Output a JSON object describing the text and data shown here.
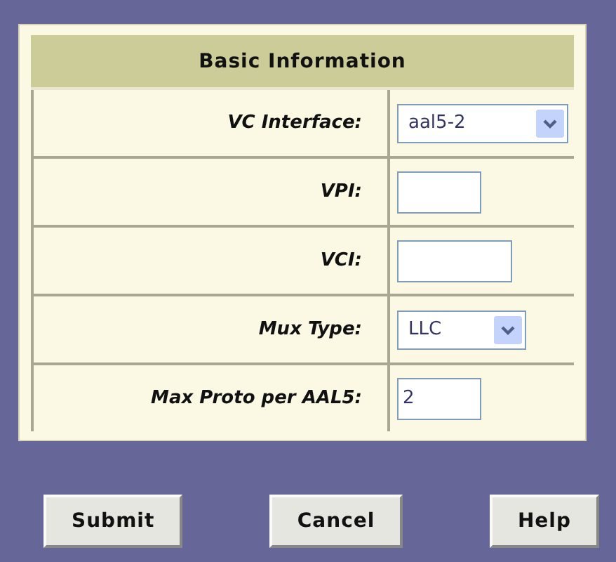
{
  "section": {
    "title": "Basic Information"
  },
  "fields": [
    {
      "label": "VC Interface:",
      "kind": "select",
      "value": "aal5-2"
    },
    {
      "label": "VPI:",
      "kind": "text"
    },
    {
      "label": "VCI:",
      "kind": "text"
    },
    {
      "label": "Mux Type:",
      "kind": "select",
      "value": "LLC"
    },
    {
      "label": "Max Proto per AAL5:",
      "kind": "text",
      "value": "2"
    }
  ],
  "buttons": [
    "Submit",
    "Cancel",
    "Help"
  ]
}
